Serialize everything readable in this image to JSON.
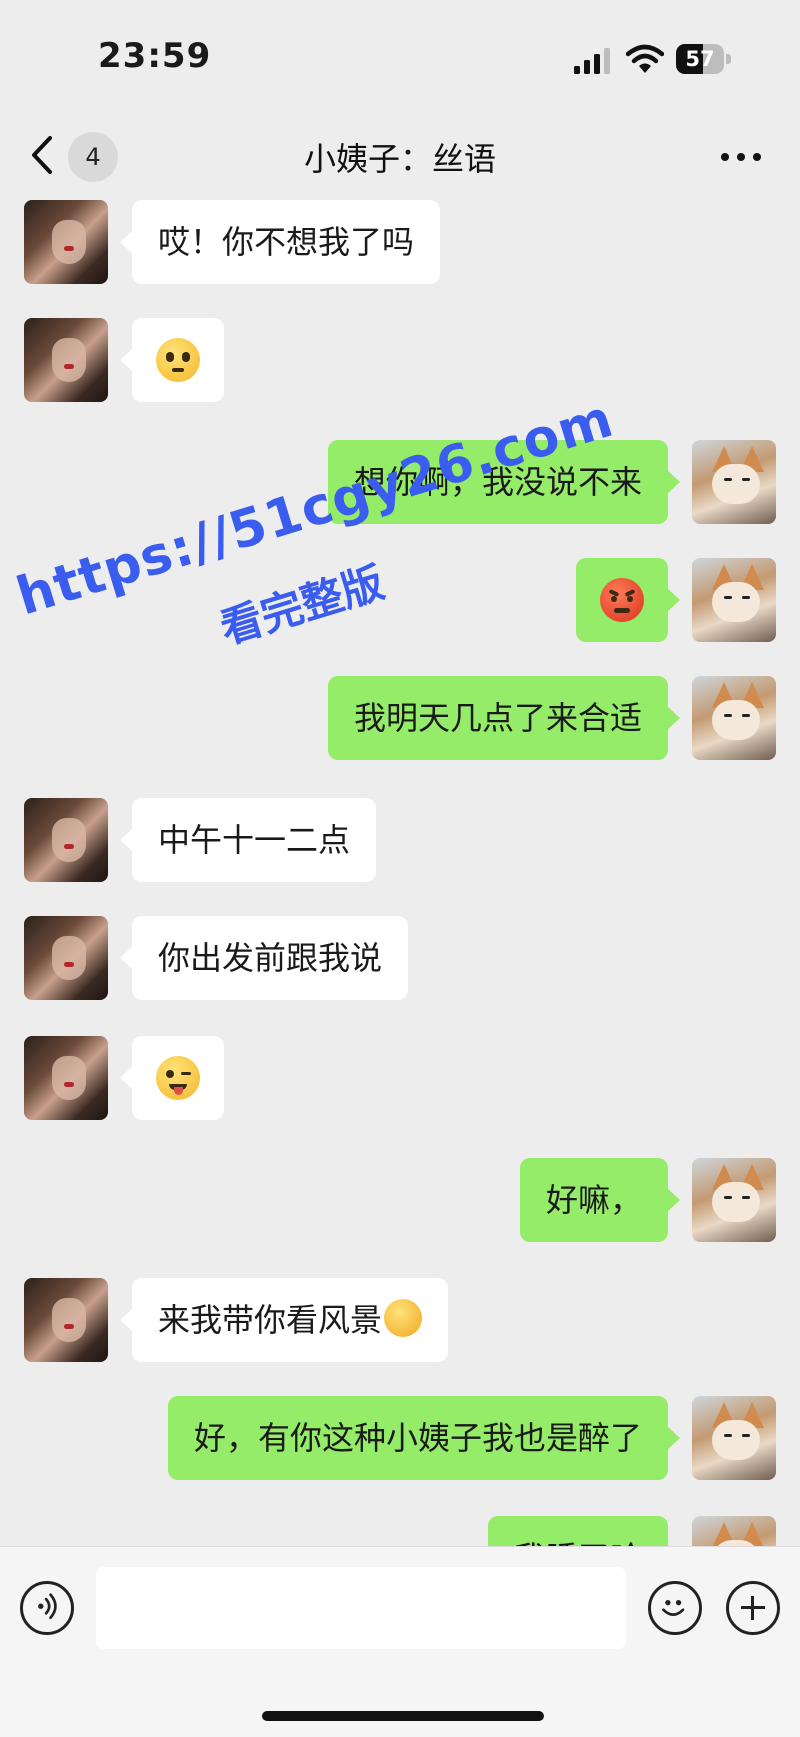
{
  "status_bar": {
    "time": "23:59",
    "battery": "57",
    "battery_level": 0.57,
    "icons": [
      "signal-icon",
      "wifi-icon",
      "battery-icon"
    ]
  },
  "nav": {
    "back_icon": "chevron-left-icon",
    "unread_count": "4",
    "title": "小姨子：丝语",
    "more_icon": "more-dots-icon"
  },
  "messages": [
    {
      "side": "in",
      "text": "哎！你不想我了吗"
    },
    {
      "side": "in",
      "emoji": "pleading-face-emoji"
    },
    {
      "side": "out",
      "text": "想你啊，我没说不来"
    },
    {
      "side": "out",
      "emoji": "angry-face-emoji"
    },
    {
      "side": "out",
      "text": "我明天几点了来合适"
    },
    {
      "side": "in",
      "text": "中午十一二点"
    },
    {
      "side": "in",
      "text": "你出发前跟我说"
    },
    {
      "side": "in",
      "emoji": "winking-tongue-emoji"
    },
    {
      "side": "out",
      "text": "好嘛，"
    },
    {
      "side": "in",
      "text": "来我带你看风景"
    },
    {
      "side": "out",
      "text": "好，有你这种小姨子我也是醉了"
    },
    {
      "side": "out",
      "text": "我睡了哈"
    }
  ],
  "watermark": {
    "line1": "https://51cgy26.com",
    "line2": "看完整版"
  },
  "input_bar": {
    "voice_icon": "voice-icon",
    "text_value": "",
    "emoji_icon": "smile-icon",
    "plus_icon": "plus-icon"
  },
  "colors": {
    "background": "#ededed",
    "outgoing_bubble": "#95ec69",
    "incoming_bubble": "#ffffff",
    "watermark": "#3a5df0"
  }
}
